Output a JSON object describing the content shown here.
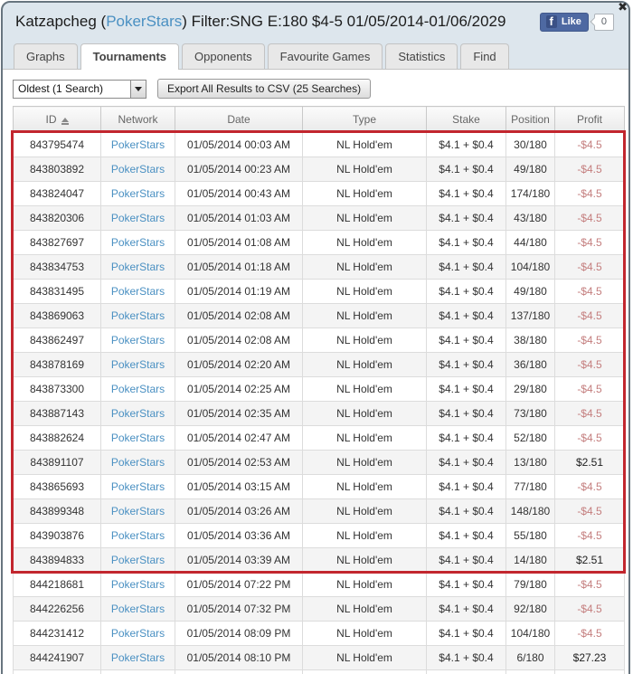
{
  "window": {
    "title_prefix": "Katzapcheg (",
    "title_link": "PokerStars",
    "title_suffix": ") Filter:SNG E:180 $4-5 01/05/2014-01/06/2029",
    "close_label": "✖"
  },
  "fb_like": {
    "f_glyph": "f",
    "label": "Like",
    "count": "0"
  },
  "tabs": [
    {
      "label": "Graphs",
      "active": false
    },
    {
      "label": "Tournaments",
      "active": true
    },
    {
      "label": "Opponents",
      "active": false
    },
    {
      "label": "Favourite Games",
      "active": false
    },
    {
      "label": "Statistics",
      "active": false
    },
    {
      "label": "Find",
      "active": false
    }
  ],
  "toolbar": {
    "sort_select_value": "Oldest (1 Search)",
    "export_button_label": "Export All Results to CSV (25 Searches)"
  },
  "table": {
    "columns": [
      "ID",
      "Network",
      "Date",
      "Type",
      "Stake",
      "Position",
      "Profit"
    ],
    "sorted_by": "ID",
    "highlighted_rows": 18,
    "rows": [
      {
        "id": "843795474",
        "network": "PokerStars",
        "date": "01/05/2014 00:03 AM",
        "type": "NL Hold'em",
        "stake": "$4.1 + $0.4",
        "position": "30/180",
        "profit": "-$4.5"
      },
      {
        "id": "843803892",
        "network": "PokerStars",
        "date": "01/05/2014 00:23 AM",
        "type": "NL Hold'em",
        "stake": "$4.1 + $0.4",
        "position": "49/180",
        "profit": "-$4.5"
      },
      {
        "id": "843824047",
        "network": "PokerStars",
        "date": "01/05/2014 00:43 AM",
        "type": "NL Hold'em",
        "stake": "$4.1 + $0.4",
        "position": "174/180",
        "profit": "-$4.5"
      },
      {
        "id": "843820306",
        "network": "PokerStars",
        "date": "01/05/2014 01:03 AM",
        "type": "NL Hold'em",
        "stake": "$4.1 + $0.4",
        "position": "43/180",
        "profit": "-$4.5"
      },
      {
        "id": "843827697",
        "network": "PokerStars",
        "date": "01/05/2014 01:08 AM",
        "type": "NL Hold'em",
        "stake": "$4.1 + $0.4",
        "position": "44/180",
        "profit": "-$4.5"
      },
      {
        "id": "843834753",
        "network": "PokerStars",
        "date": "01/05/2014 01:18 AM",
        "type": "NL Hold'em",
        "stake": "$4.1 + $0.4",
        "position": "104/180",
        "profit": "-$4.5"
      },
      {
        "id": "843831495",
        "network": "PokerStars",
        "date": "01/05/2014 01:19 AM",
        "type": "NL Hold'em",
        "stake": "$4.1 + $0.4",
        "position": "49/180",
        "profit": "-$4.5"
      },
      {
        "id": "843869063",
        "network": "PokerStars",
        "date": "01/05/2014 02:08 AM",
        "type": "NL Hold'em",
        "stake": "$4.1 + $0.4",
        "position": "137/180",
        "profit": "-$4.5"
      },
      {
        "id": "843862497",
        "network": "PokerStars",
        "date": "01/05/2014 02:08 AM",
        "type": "NL Hold'em",
        "stake": "$4.1 + $0.4",
        "position": "38/180",
        "profit": "-$4.5"
      },
      {
        "id": "843878169",
        "network": "PokerStars",
        "date": "01/05/2014 02:20 AM",
        "type": "NL Hold'em",
        "stake": "$4.1 + $0.4",
        "position": "36/180",
        "profit": "-$4.5"
      },
      {
        "id": "843873300",
        "network": "PokerStars",
        "date": "01/05/2014 02:25 AM",
        "type": "NL Hold'em",
        "stake": "$4.1 + $0.4",
        "position": "29/180",
        "profit": "-$4.5"
      },
      {
        "id": "843887143",
        "network": "PokerStars",
        "date": "01/05/2014 02:35 AM",
        "type": "NL Hold'em",
        "stake": "$4.1 + $0.4",
        "position": "73/180",
        "profit": "-$4.5"
      },
      {
        "id": "843882624",
        "network": "PokerStars",
        "date": "01/05/2014 02:47 AM",
        "type": "NL Hold'em",
        "stake": "$4.1 + $0.4",
        "position": "52/180",
        "profit": "-$4.5"
      },
      {
        "id": "843891107",
        "network": "PokerStars",
        "date": "01/05/2014 02:53 AM",
        "type": "NL Hold'em",
        "stake": "$4.1 + $0.4",
        "position": "13/180",
        "profit": "$2.51"
      },
      {
        "id": "843865693",
        "network": "PokerStars",
        "date": "01/05/2014 03:15 AM",
        "type": "NL Hold'em",
        "stake": "$4.1 + $0.4",
        "position": "77/180",
        "profit": "-$4.5"
      },
      {
        "id": "843899348",
        "network": "PokerStars",
        "date": "01/05/2014 03:26 AM",
        "type": "NL Hold'em",
        "stake": "$4.1 + $0.4",
        "position": "148/180",
        "profit": "-$4.5"
      },
      {
        "id": "843903876",
        "network": "PokerStars",
        "date": "01/05/2014 03:36 AM",
        "type": "NL Hold'em",
        "stake": "$4.1 + $0.4",
        "position": "55/180",
        "profit": "-$4.5"
      },
      {
        "id": "843894833",
        "network": "PokerStars",
        "date": "01/05/2014 03:39 AM",
        "type": "NL Hold'em",
        "stake": "$4.1 + $0.4",
        "position": "14/180",
        "profit": "$2.51"
      },
      {
        "id": "844218681",
        "network": "PokerStars",
        "date": "01/05/2014 07:22 PM",
        "type": "NL Hold'em",
        "stake": "$4.1 + $0.4",
        "position": "79/180",
        "profit": "-$4.5"
      },
      {
        "id": "844226256",
        "network": "PokerStars",
        "date": "01/05/2014 07:32 PM",
        "type": "NL Hold'em",
        "stake": "$4.1 + $0.4",
        "position": "92/180",
        "profit": "-$4.5"
      },
      {
        "id": "844231412",
        "network": "PokerStars",
        "date": "01/05/2014 08:09 PM",
        "type": "NL Hold'em",
        "stake": "$4.1 + $0.4",
        "position": "104/180",
        "profit": "-$4.5"
      },
      {
        "id": "844241907",
        "network": "PokerStars",
        "date": "01/05/2014 08:10 PM",
        "type": "NL Hold'em",
        "stake": "$4.1 + $0.4",
        "position": "6/180",
        "profit": "$27.23"
      }
    ]
  },
  "colors": {
    "highlight_border": "#c2262e",
    "link_blue": "#4a90c2",
    "loss_red": "#c47e7e",
    "fb_blue": "#4e69a2",
    "header_bg": "#dde6ed"
  }
}
